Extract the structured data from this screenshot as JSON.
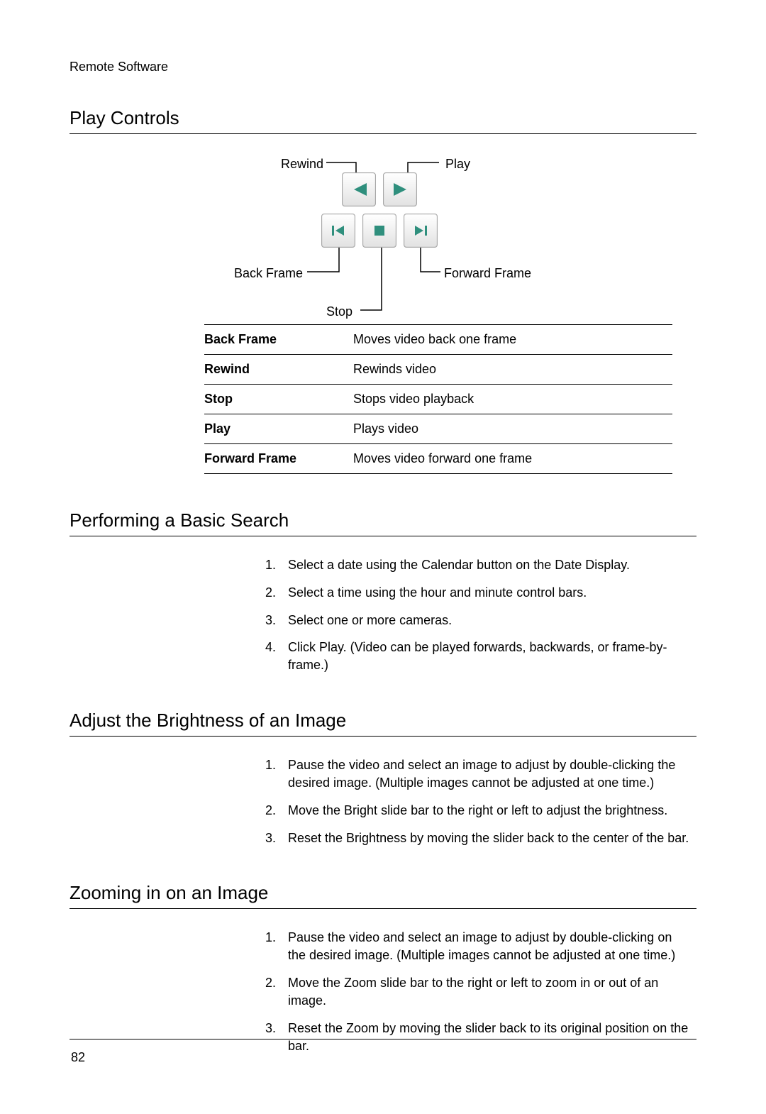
{
  "running_head": "Remote Software",
  "page_number": "82",
  "sections": {
    "play_controls": {
      "title": "Play Controls",
      "labels": {
        "rewind": "Rewind",
        "play": "Play",
        "back_frame": "Back Frame",
        "forward_frame": "Forward Frame",
        "stop": "Stop"
      },
      "rows": [
        {
          "term": "Back Frame",
          "desc": "Moves video back one frame"
        },
        {
          "term": "Rewind",
          "desc": "Rewinds video"
        },
        {
          "term": "Stop",
          "desc": "Stops video playback"
        },
        {
          "term": "Play",
          "desc": "Plays video"
        },
        {
          "term": "Forward Frame",
          "desc": "Moves video forward one frame"
        }
      ]
    },
    "basic_search": {
      "title": "Performing a Basic Search",
      "steps": [
        "Select a date using the Calendar button on the Date Display.",
        "Select a time using the hour and minute control bars.",
        "Select one or more cameras.",
        "Click Play. (Video can be played forwards, backwards, or frame-by-frame.)"
      ]
    },
    "adjust_brightness": {
      "title": "Adjust the Brightness of an Image",
      "steps": [
        "Pause the video and select an image to adjust by double-clicking the desired image. (Multiple images cannot be adjusted at one time.)",
        "Move the Bright slide bar to the right or left to adjust the brightness.",
        "Reset the Brightness by moving the slider back to the center of the bar."
      ]
    },
    "zooming": {
      "title": "Zooming in on an Image",
      "steps": [
        "Pause the video and select an image to adjust by double-clicking on the desired image. (Multiple images cannot be adjusted at one time.)",
        "Move the Zoom slide bar to the right or left to zoom in or out of an image.",
        "Reset the Zoom by moving the slider back to its original position on the bar."
      ]
    }
  }
}
